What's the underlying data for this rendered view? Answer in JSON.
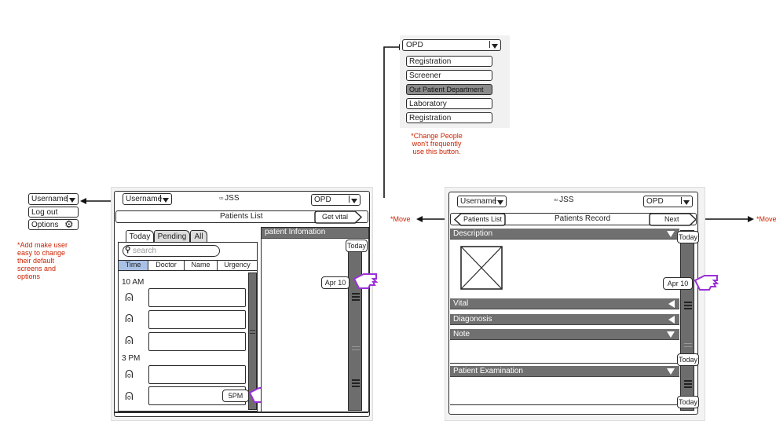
{
  "dropdown_panel": {
    "selected": "OPD",
    "options": [
      "Registration",
      "Screener",
      "Out Patient Department",
      "Laboratory",
      "Registration"
    ],
    "highlighted_index": 2,
    "note": "*Change People won't frequently use this button."
  },
  "user_menu": {
    "username": "Username",
    "items": [
      "Log out",
      "Options"
    ],
    "note": "*Add make user easy to change their default screens and options"
  },
  "left_screen": {
    "username": "Username",
    "app_title": "JSS",
    "department": "OPD",
    "page_title": "Patients List",
    "get_vital_label": "Get vital",
    "tabs": [
      "Today",
      "Pending",
      "All"
    ],
    "search_placeholder": "search",
    "columns": [
      "Time",
      "Doctor",
      "Name",
      "Urgency"
    ],
    "time_groups": [
      "10 AM",
      "3 PM"
    ],
    "info_header": "patent Infomation",
    "today_label": "Today",
    "apr_label": "Apr 10",
    "pm_label": "5PM"
  },
  "right_screen": {
    "username": "Username",
    "app_title": "JSS",
    "department": "OPD",
    "back_label": "Patients List",
    "page_title": "Patients Record",
    "next_label": "Next",
    "move_left": "*Move",
    "move_right": "*Move",
    "sections": [
      "Description",
      "Vital",
      "Diagonosis",
      "Note",
      "Patient Examination"
    ],
    "today_top": "Today",
    "apr_label": "Apr 10",
    "today_mid": "Today",
    "today_bottom": "Today"
  }
}
